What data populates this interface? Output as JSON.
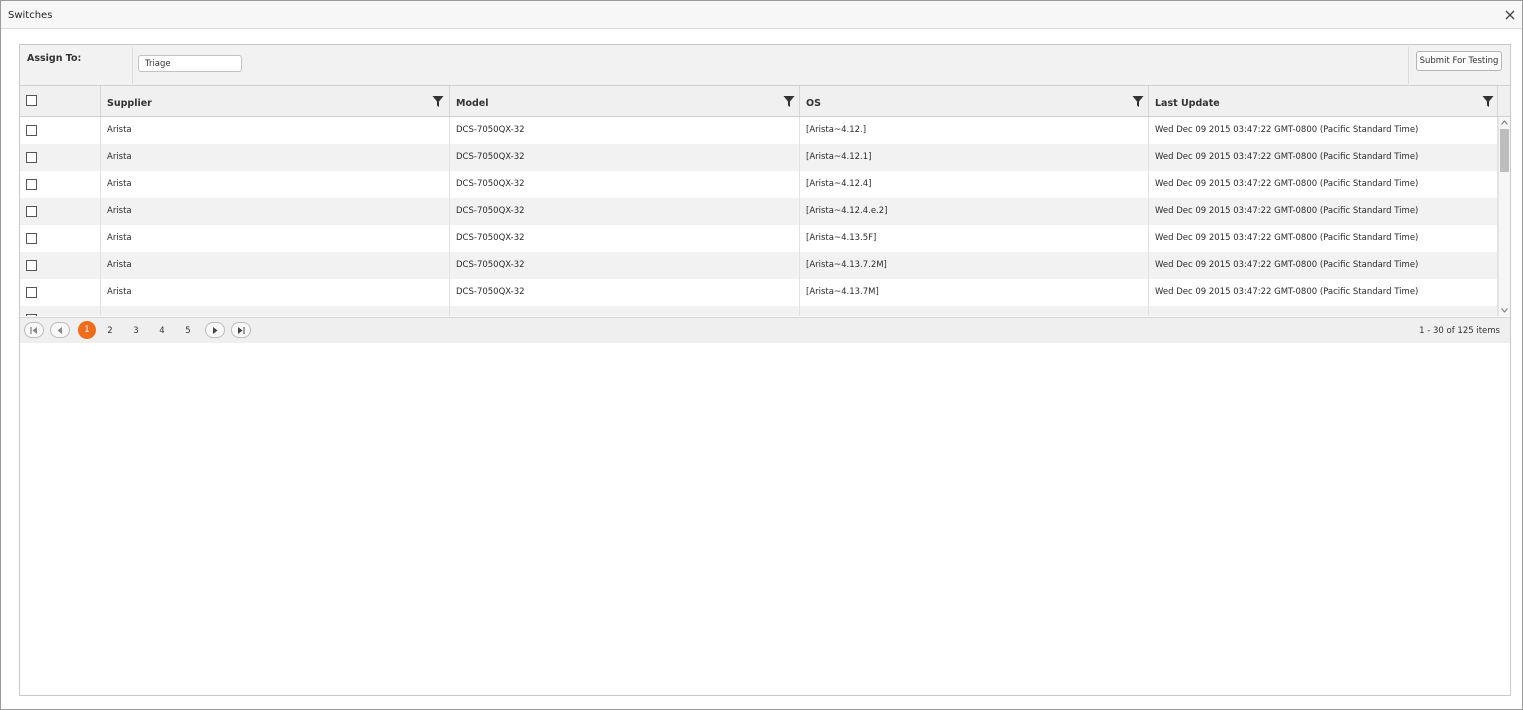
{
  "window": {
    "title": "Switches"
  },
  "toolbar": {
    "assign_label": "Assign To:",
    "assign_value": "Triage",
    "submit_label": "Submit For Testing"
  },
  "grid": {
    "columns": [
      "Supplier",
      "Model",
      "OS",
      "Last Update"
    ],
    "rows": [
      {
        "supplier": "Arista",
        "model": "DCS-7050QX-32",
        "os": "[Arista~4.12.]",
        "last_update": "Wed Dec 09 2015 03:47:22 GMT-0800 (Pacific Standard Time)"
      },
      {
        "supplier": "Arista",
        "model": "DCS-7050QX-32",
        "os": "[Arista~4.12.1]",
        "last_update": "Wed Dec 09 2015 03:47:22 GMT-0800 (Pacific Standard Time)"
      },
      {
        "supplier": "Arista",
        "model": "DCS-7050QX-32",
        "os": "[Arista~4.12.4]",
        "last_update": "Wed Dec 09 2015 03:47:22 GMT-0800 (Pacific Standard Time)"
      },
      {
        "supplier": "Arista",
        "model": "DCS-7050QX-32",
        "os": "[Arista~4.12.4.e.2]",
        "last_update": "Wed Dec 09 2015 03:47:22 GMT-0800 (Pacific Standard Time)"
      },
      {
        "supplier": "Arista",
        "model": "DCS-7050QX-32",
        "os": "[Arista~4.13.5F]",
        "last_update": "Wed Dec 09 2015 03:47:22 GMT-0800 (Pacific Standard Time)"
      },
      {
        "supplier": "Arista",
        "model": "DCS-7050QX-32",
        "os": "[Arista~4.13.7.2M]",
        "last_update": "Wed Dec 09 2015 03:47:22 GMT-0800 (Pacific Standard Time)"
      },
      {
        "supplier": "Arista",
        "model": "DCS-7050QX-32",
        "os": "[Arista~4.13.7M]",
        "last_update": "Wed Dec 09 2015 03:47:22 GMT-0800 (Pacific Standard Time)"
      }
    ]
  },
  "pager": {
    "pages": [
      "1",
      "2",
      "3",
      "4",
      "5"
    ],
    "current_page": "1",
    "info": "1 - 30 of 125 items"
  },
  "colors": {
    "accent": "#ef6c1a",
    "alt_row": "#f2f2f2",
    "header_bg": "#f0f0f0"
  },
  "icons": [
    "close-icon",
    "filter-icon",
    "first-page-icon",
    "prev-page-icon",
    "next-page-icon",
    "last-page-icon",
    "scroll-up-icon",
    "scroll-down-icon"
  ]
}
